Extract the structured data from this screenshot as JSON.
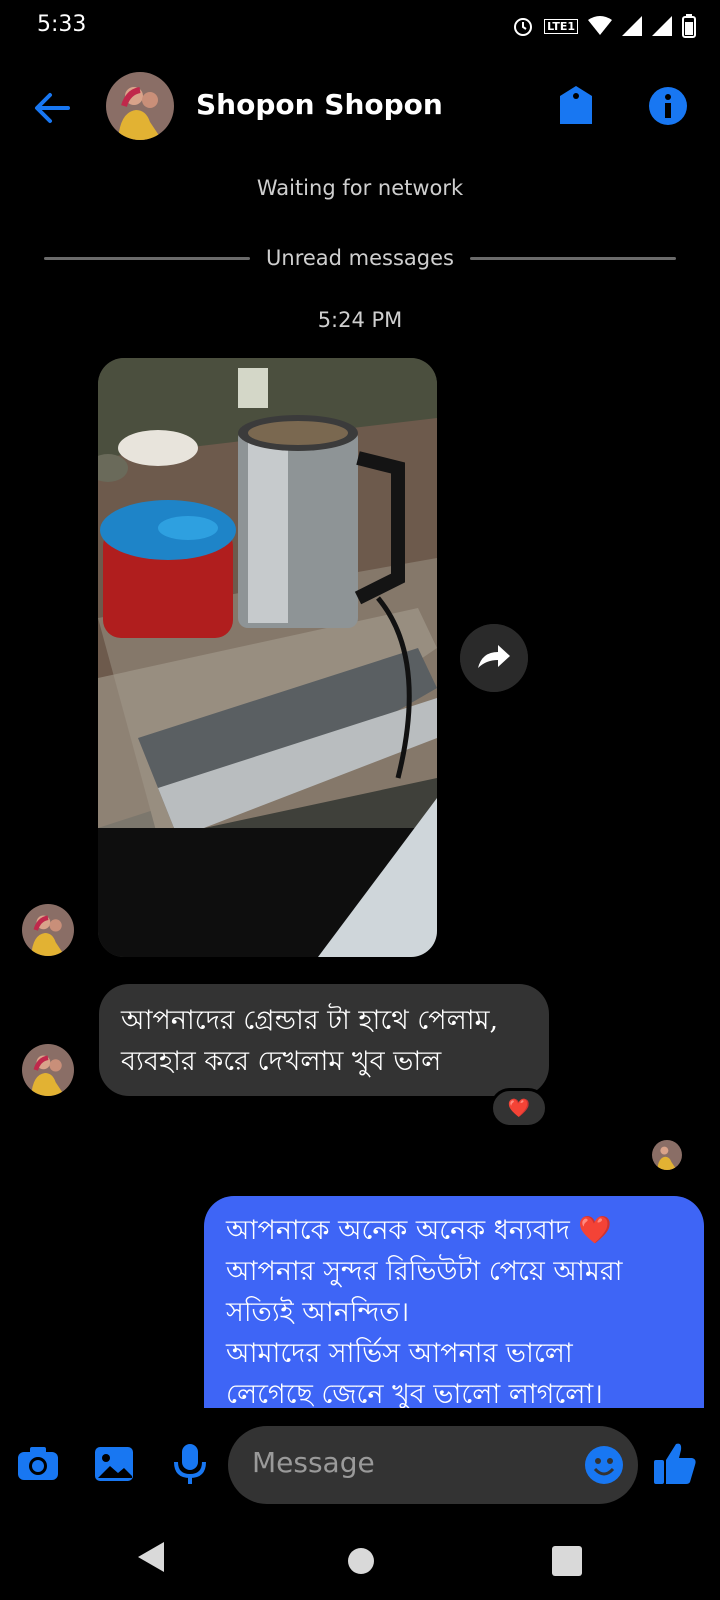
{
  "status_bar": {
    "time": "5:33",
    "network_label": "LTE1"
  },
  "header": {
    "name": "Shopon Shopon"
  },
  "conversation": {
    "network_status": "Waiting for network",
    "unread_label": "Unread messages",
    "timestamp": "5:24 PM",
    "incoming_text_line1": "আপনাদের গ্রেন্ডার টা হাথে পেলাম,",
    "incoming_text_line2": "ব্যবহার করে দেখলাম খুব ভাল",
    "reaction": "❤️",
    "outgoing_lines": [
      "আপনাকে অনেক অনেক ধন্যবাদ ❤️",
      "আপনার সুন্দর রিভিউটা পেয়ে আমরা",
      "সত্যিই আনন্দিত।",
      "আমাদের সার্ভিস আপনার ভালো",
      "লেগেছে জেনে খুব ভালো লাগলো।"
    ]
  },
  "composer": {
    "placeholder": "Message"
  },
  "colors": {
    "accent": "#1877f2",
    "outgoing_bubble": "#3e65f6",
    "incoming_bubble": "#333333"
  }
}
